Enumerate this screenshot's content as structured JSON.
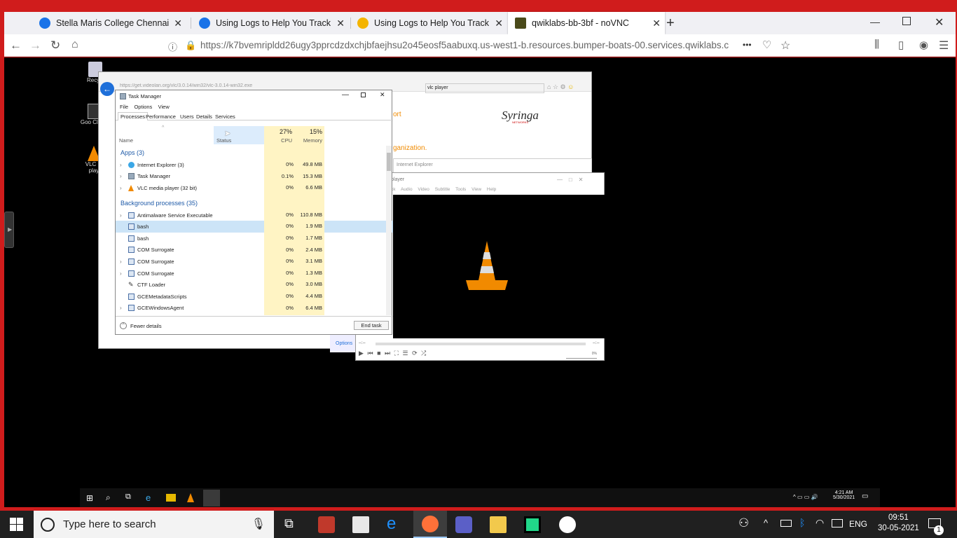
{
  "browser": {
    "tabs": [
      {
        "title": "Stella Maris College Chennai on",
        "icon": "google-c-icon",
        "color": "#1a73e8"
      },
      {
        "title": "Using Logs to Help You Track D",
        "icon": "google-c-icon",
        "color": "#1a73e8"
      },
      {
        "title": "Using Logs to Help You Track D",
        "icon": "qwiklabs-icon",
        "color": "#f4b400"
      },
      {
        "title": "qwiklabs-bb-3bf - noVNC",
        "icon": "vnc-icon",
        "color": "#4a4a1a"
      }
    ],
    "new_tab": "+",
    "url": "https://k7bvemripldd26ugy3pprcdzdxchjbfaejhsu2o45eosf5aabuxq.us-west1-b.resources.bumper-boats-00.services.qwiklabs.c",
    "more": "•••"
  },
  "remote": {
    "desktop_icons": [
      {
        "label": "Recycl"
      },
      {
        "label": "Goo Cloud"
      },
      {
        "label": "VLC m play"
      }
    ],
    "ie": {
      "url": "https://get.videolan.org/vlc/3.0.14/win32/vlc-3.0.14-win32.exe",
      "search": "vlc player",
      "brand": "Syringa",
      "brand_sub": "NETWORKS",
      "orange_text1": "ort",
      "orange_text2": "ganization.",
      "dialog_title": "Internet Explorer",
      "options": "Options"
    },
    "task_manager": {
      "title": "Task Manager",
      "menu": [
        "File",
        "Options",
        "View"
      ],
      "tabs": [
        "Processes",
        "Performance",
        "Users",
        "Details",
        "Services"
      ],
      "col_name": "Name",
      "col_status": "Status",
      "cpu_pct": "27%",
      "cpu_label": "CPU",
      "mem_pct": "15%",
      "mem_label": "Memory",
      "apps_header": "Apps (3)",
      "bg_header": "Background processes (35)",
      "apps": [
        {
          "name": "Internet Explorer (3)",
          "cpu": "0%",
          "mem": "49.8 MB",
          "icon": "ie-icon"
        },
        {
          "name": "Task Manager",
          "cpu": "0.1%",
          "mem": "15.3 MB",
          "icon": "taskmgr-icon"
        },
        {
          "name": "VLC media player (32 bit)",
          "cpu": "0%",
          "mem": "6.6 MB",
          "icon": "vlc-icon"
        }
      ],
      "bg": [
        {
          "name": "Antimalware Service Executable",
          "cpu": "0%",
          "mem": "110.8 MB"
        },
        {
          "name": "bash",
          "cpu": "0%",
          "mem": "1.9 MB"
        },
        {
          "name": "bash",
          "cpu": "0%",
          "mem": "1.7 MB"
        },
        {
          "name": "COM Surrogate",
          "cpu": "0%",
          "mem": "2.4 MB"
        },
        {
          "name": "COM Surrogate",
          "cpu": "0%",
          "mem": "3.1 MB"
        },
        {
          "name": "COM Surrogate",
          "cpu": "0%",
          "mem": "1.3 MB"
        },
        {
          "name": "CTF Loader",
          "cpu": "0%",
          "mem": "3.0 MB"
        },
        {
          "name": "GCEMetadataScripts",
          "cpu": "0%",
          "mem": "4.4 MB"
        },
        {
          "name": "GCEWindowsAgent",
          "cpu": "0%",
          "mem": "6.4 MB"
        }
      ],
      "fewer_details": "Fewer details",
      "end_task": "End task"
    },
    "vlc": {
      "title": "player",
      "menu": [
        "ck",
        "Audio",
        "Video",
        "Subtitle",
        "Tools",
        "View",
        "Help"
      ],
      "time_left": "--:--",
      "time_right": "--:--",
      "volume": "0%"
    },
    "clock_time": "4:21 AM",
    "clock_date": "5/30/2021"
  },
  "taskbar": {
    "search_placeholder": "Type here to search",
    "lang": "ENG",
    "time": "09:51",
    "date": "30-05-2021",
    "notif_count": "1"
  }
}
